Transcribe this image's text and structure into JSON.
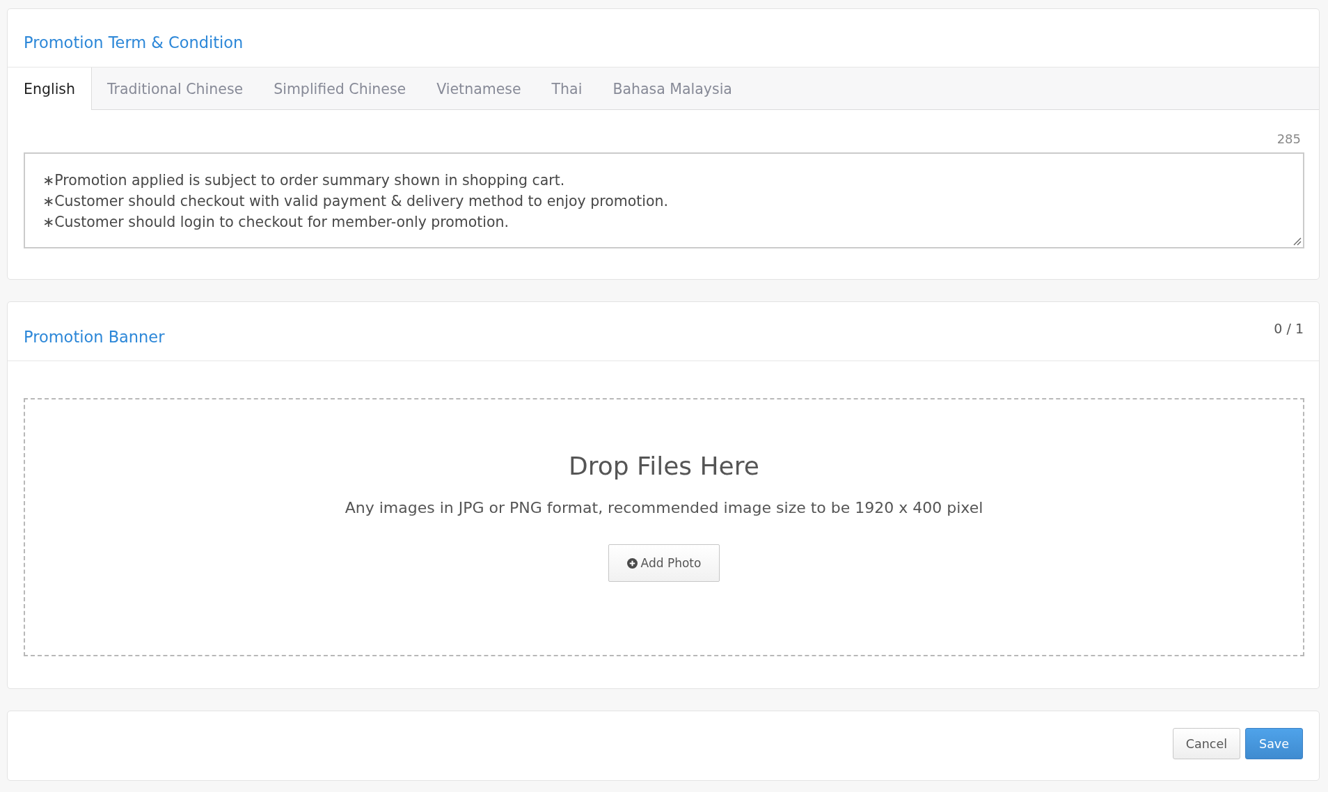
{
  "terms": {
    "title": "Promotion Term & Condition",
    "tabs": [
      {
        "label": "English",
        "selected": true
      },
      {
        "label": "Traditional Chinese",
        "selected": false
      },
      {
        "label": "Simplified Chinese",
        "selected": false
      },
      {
        "label": "Vietnamese",
        "selected": false
      },
      {
        "label": "Thai",
        "selected": false
      },
      {
        "label": "Bahasa Malaysia",
        "selected": false
      }
    ],
    "char_count": "285",
    "text_lines": [
      "∗Promotion applied is subject to order summary shown in shopping cart.",
      "∗Customer should checkout with valid payment & delivery method to enjoy promotion.",
      "∗Customer should login to checkout for member-only promotion."
    ]
  },
  "banner": {
    "title": "Promotion Banner",
    "count": "0 / 1",
    "dropzone": {
      "heading": "Drop Files Here",
      "hint": "Any images in JPG or PNG format, recommended image size to be 1920 x 400 pixel",
      "button": "Add Photo"
    }
  },
  "buttons": [
    {
      "label": "Cancel",
      "kind": "default"
    },
    {
      "label": "Save",
      "kind": "primary"
    }
  ]
}
